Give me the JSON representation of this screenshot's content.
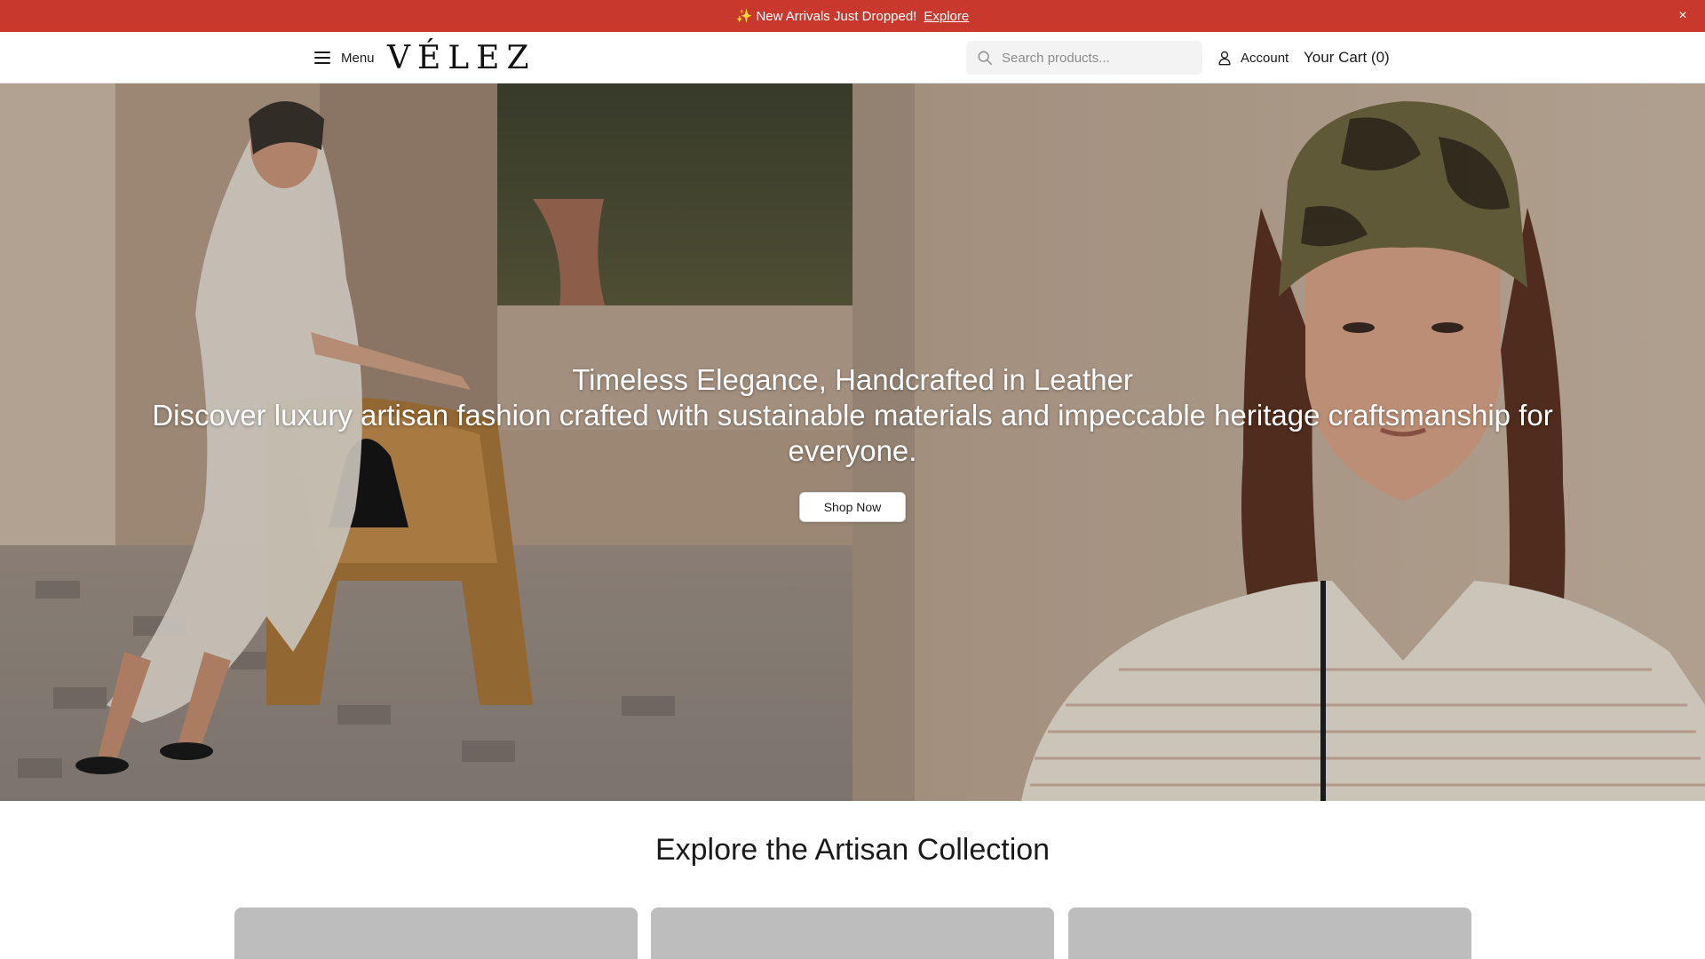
{
  "announcement": {
    "icon": "sparkles-icon",
    "spark_glyph": "✨",
    "message": "New Arrivals Just Dropped!",
    "link_label": "Explore",
    "close_glyph": "×"
  },
  "header": {
    "menu_label": "Menu",
    "logo": "VÉLEZ",
    "search_placeholder": "Search products...",
    "account_label": "Account",
    "cart_label": "Your Cart (0)"
  },
  "hero": {
    "title": "Timeless Elegance, Handcrafted in Leather",
    "subtitle": "Discover luxury artisan fashion crafted with sustainable materials and impeccable heritage craftsmanship for everyone.",
    "cta_label": "Shop Now"
  },
  "collection": {
    "title": "Explore the Artisan Collection",
    "cards": [
      {
        "name": "collection-card-1"
      },
      {
        "name": "collection-card-2"
      },
      {
        "name": "collection-card-3"
      }
    ]
  },
  "colors": {
    "announcement_bg": "#c8382d",
    "card_placeholder": "#bdbdbd"
  }
}
